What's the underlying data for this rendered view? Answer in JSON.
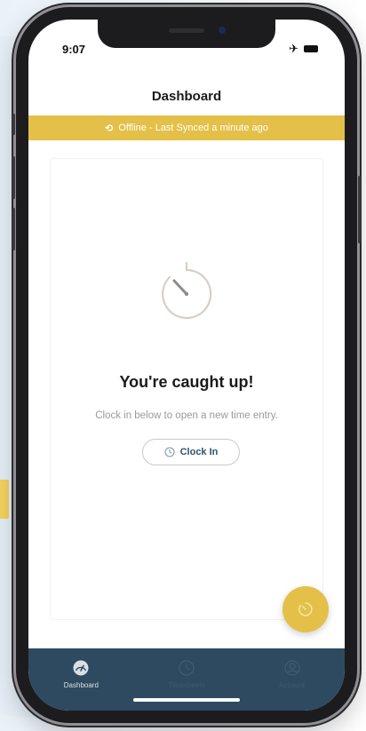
{
  "status_bar": {
    "time": "9:07",
    "airplane_glyph": "✈"
  },
  "header": {
    "title": "Dashboard"
  },
  "offline_banner": {
    "icon": "sync-icon",
    "glyph": "⟲",
    "text": "Offline - Last Synced a minute ago"
  },
  "empty_state": {
    "icon": "timer-icon",
    "title": "You're caught up!",
    "subtitle": "Clock in below to open a new time entry.",
    "button_label": "Clock In"
  },
  "fab": {
    "icon": "clock-in-fab-icon"
  },
  "tabs": [
    {
      "label": "Dashboard",
      "icon": "dashboard-icon",
      "active": true
    },
    {
      "label": "Timesheets",
      "icon": "clock-icon",
      "active": false
    },
    {
      "label": "Account",
      "icon": "account-icon",
      "active": false
    }
  ],
  "colors": {
    "accent": "#e4c049",
    "tab_bar": "#2e4a60",
    "button_text": "#2c5470"
  }
}
